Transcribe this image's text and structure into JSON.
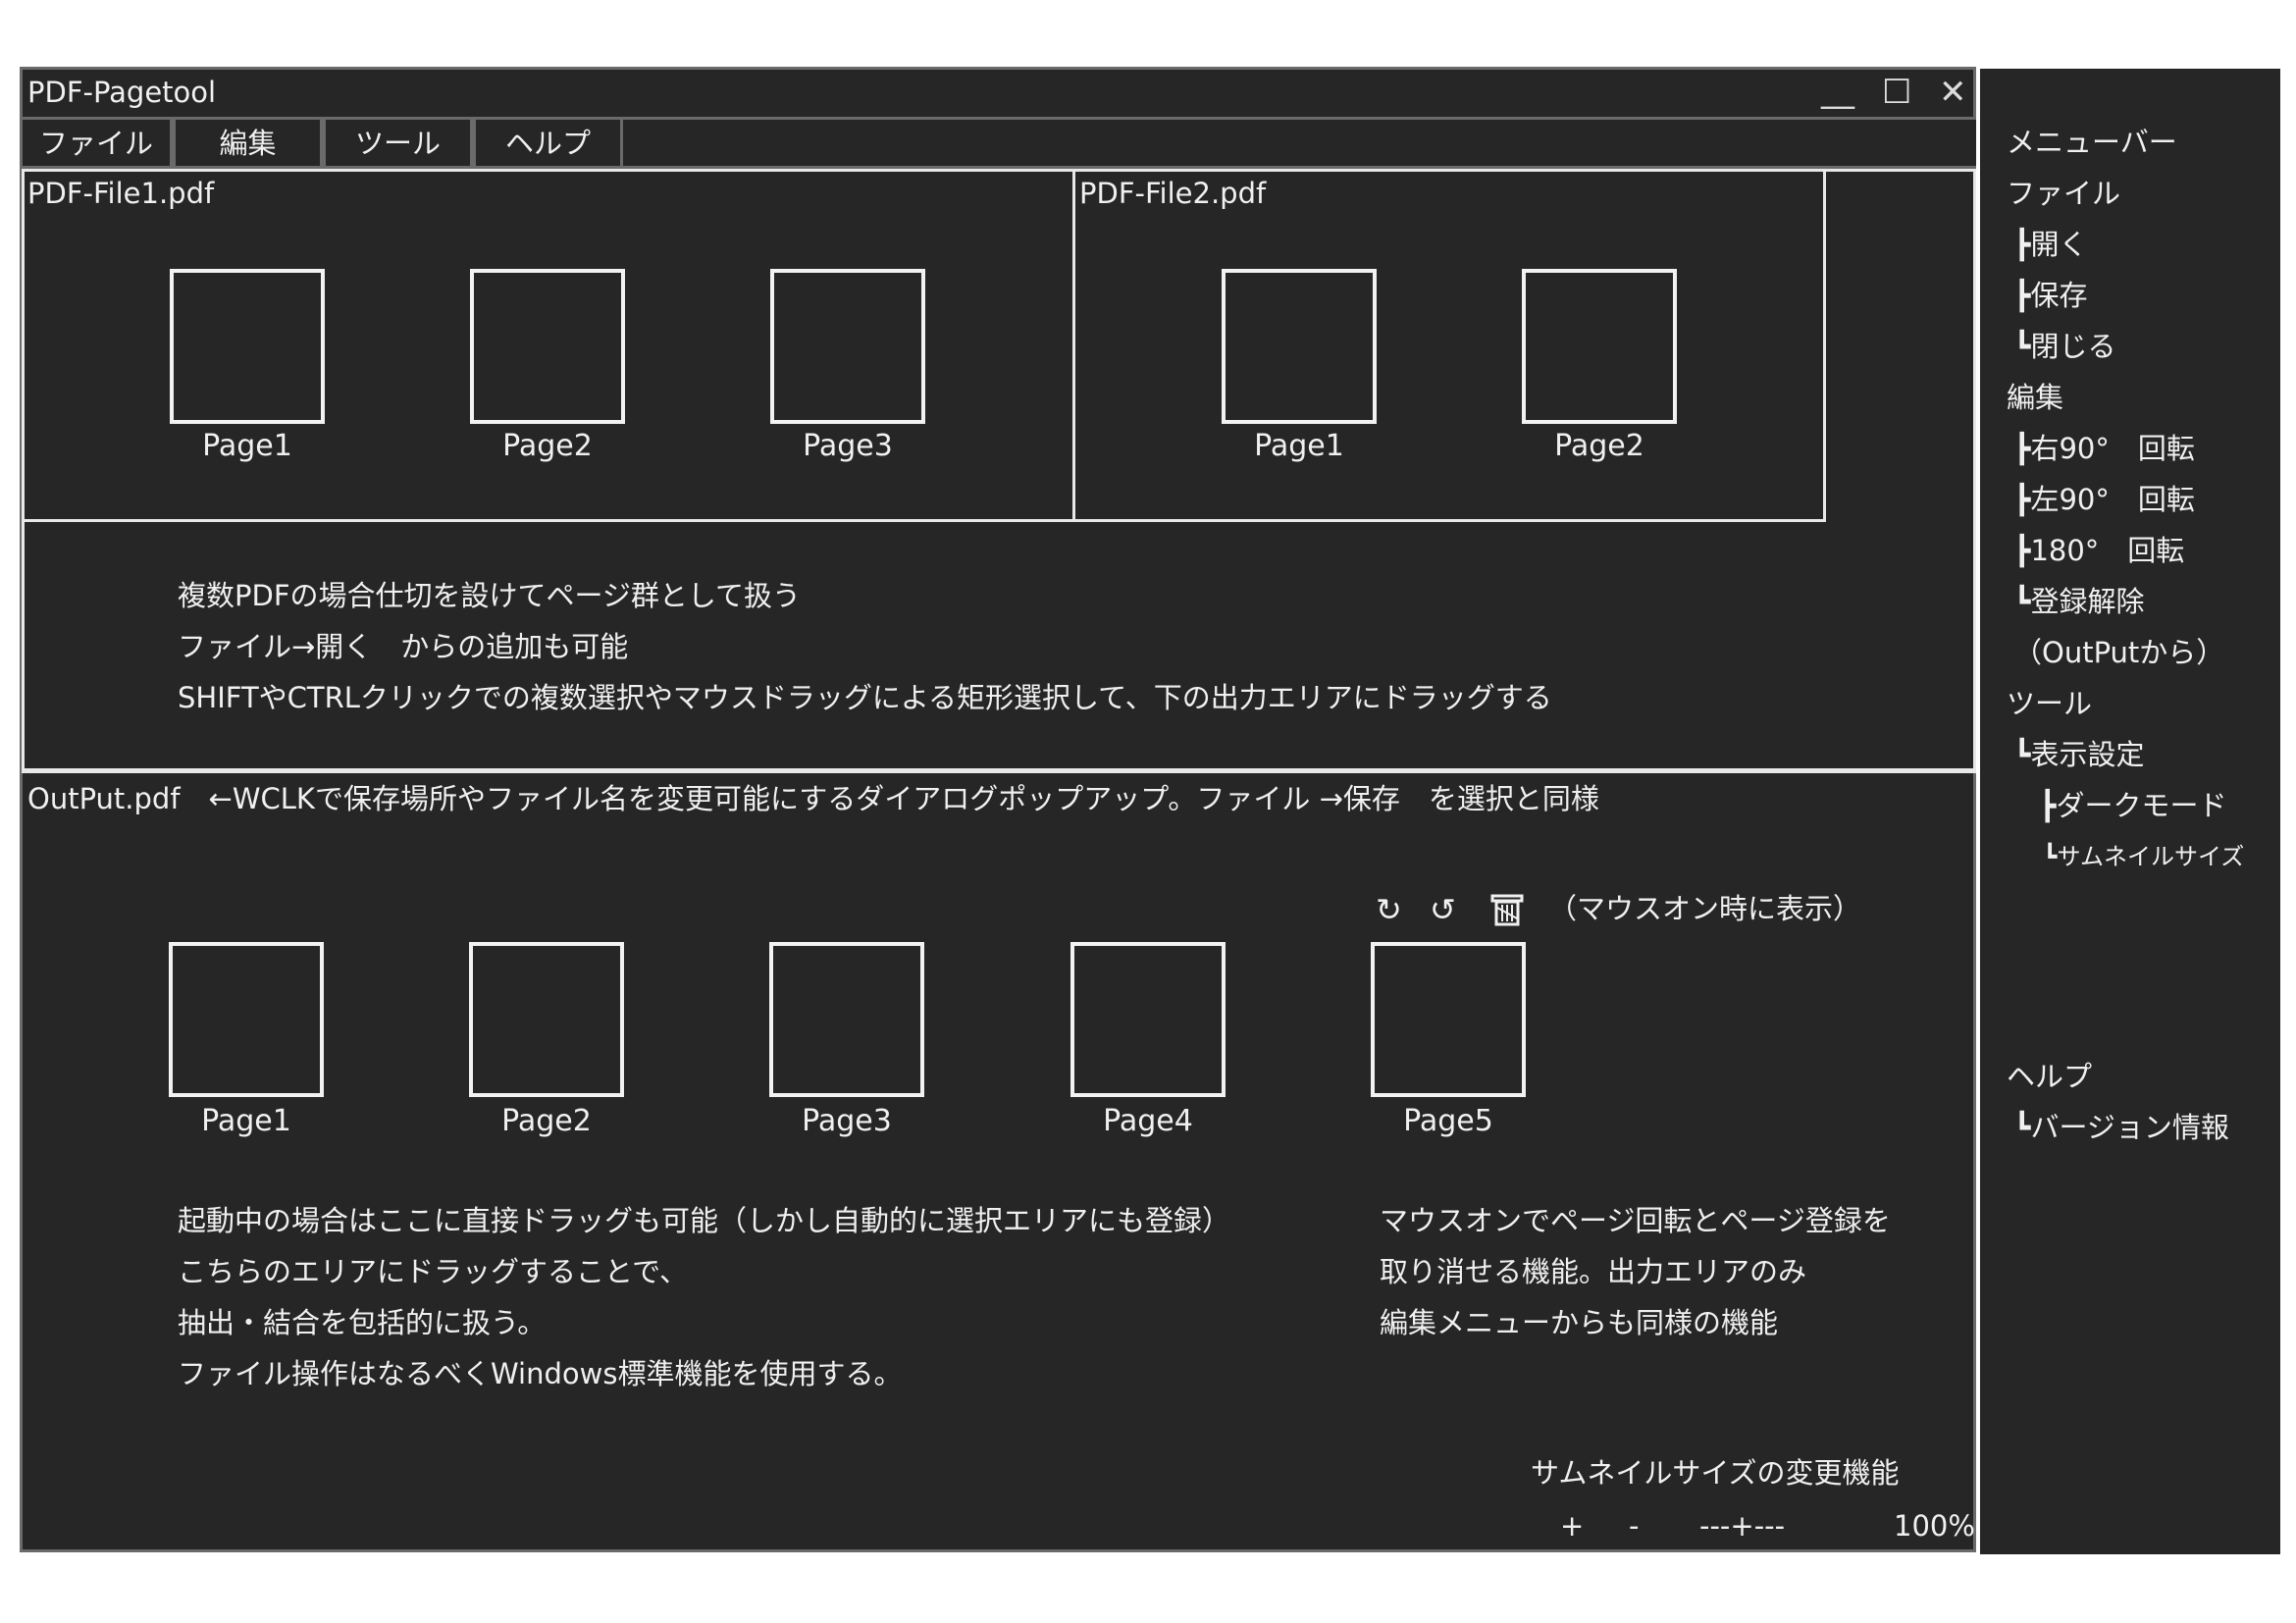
{
  "window": {
    "title": "PDF-Pagetool",
    "controls": {
      "minimize": "__",
      "maximize": "☐",
      "close": "✕"
    }
  },
  "menubar": [
    "ファイル",
    "編集",
    "ツール",
    "ヘルプ"
  ],
  "input_area": {
    "files": [
      {
        "name": "PDF-File1.pdf",
        "pages": [
          "Page1",
          "Page2",
          "Page3"
        ]
      },
      {
        "name": "PDF-File2.pdf",
        "pages": [
          "Page1",
          "Page2"
        ]
      }
    ],
    "notes": [
      "複数PDFの場合仕切を設けてページ群として扱う",
      "ファイル→開く　からの追加も可能",
      "SHIFTやCTRLクリックでの複数選択やマウスドラッグによる矩形選択して、下の出力エリアにドラッグする"
    ]
  },
  "output_area": {
    "header": "OutPut.pdf　←WCLKで保存場所やファイル名を変更可能にするダイアログポップアップ。ファイル →保存　を選択と同様",
    "pages": [
      "Page1",
      "Page2",
      "Page3",
      "Page4",
      "Page5"
    ],
    "hover_icons": [
      "rotate-right-icon",
      "rotate-left-icon",
      "trash-icon"
    ],
    "hover_note": "（マウスオン時に表示）",
    "notes_left": [
      "起動中の場合はここに直接ドラッグも可能（しかし自動的に選択エリアにも登録）",
      "こちらのエリアにドラッグすることで、",
      "抽出・結合を包括的に扱う。",
      "ファイル操作はなるべくWindows標準機能を使用する。"
    ],
    "notes_right": [
      "マウスオンでページ回転とページ登録を",
      "取り消せる機能。出力エリアのみ",
      "編集メニューからも同様の機能"
    ],
    "thumbnail_size": {
      "title": "サムネイルサイズの変更機能",
      "plus": "+",
      "minus": "-",
      "slider": "---+---",
      "zoom": "100%"
    }
  },
  "side_panel": {
    "items": [
      "メニューバー",
      "ファイル",
      "┣開く",
      "┣保存",
      "┗閉じる",
      "編集",
      "┣右90°　回転",
      "┣左90°　回転",
      "┣180°　回転",
      "┗登録解除",
      "（OutPutから）",
      "ツール",
      "┗表示設定",
      "┣ダークモード",
      "┗サムネイルサイズ",
      "ヘルプ",
      "┗バージョン情報"
    ]
  }
}
